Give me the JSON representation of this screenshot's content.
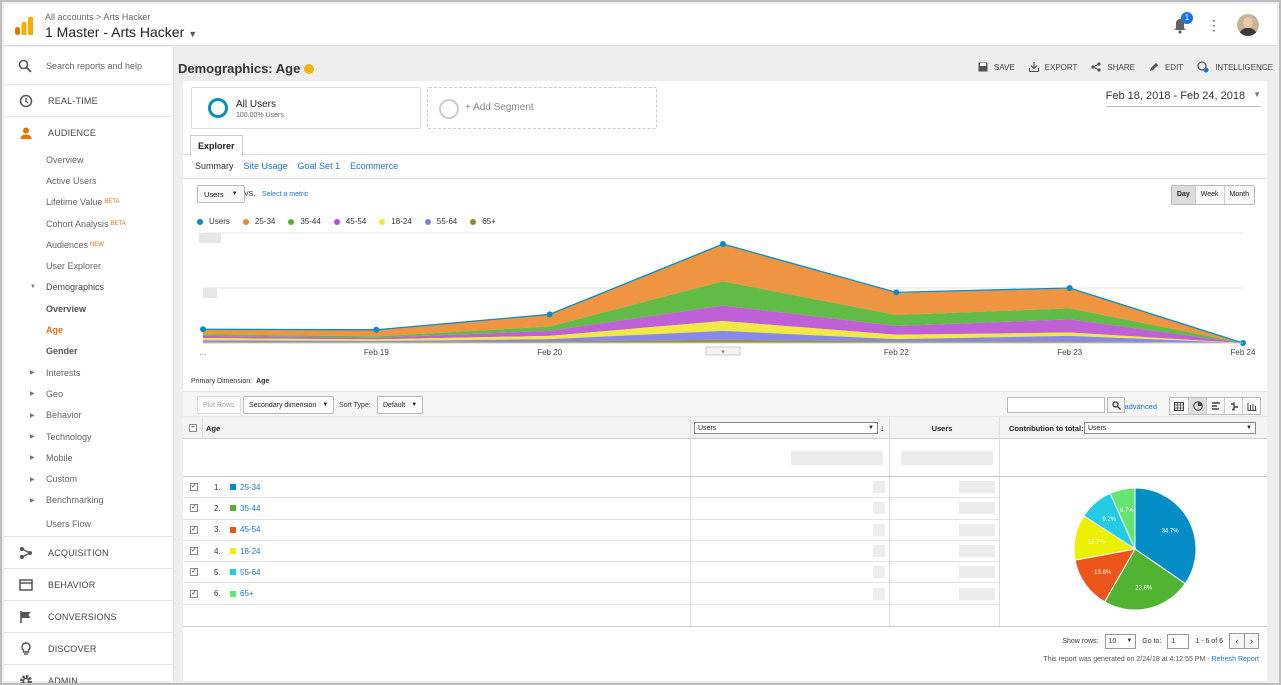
{
  "header": {
    "breadcrumb_accounts": "All accounts",
    "breadcrumb_sep": ">",
    "breadcrumb_property": "Arts Hacker",
    "account_title": "1 Master - Arts Hacker",
    "notification_count": "1"
  },
  "sidebar": {
    "search_placeholder": "Search reports and help",
    "main_items": {
      "realtime": "REAL-TIME",
      "audience": "AUDIENCE",
      "acquisition": "ACQUISITION",
      "behavior": "BEHAVIOR",
      "conversions": "CONVERSIONS",
      "discover": "DISCOVER",
      "admin": "ADMIN"
    },
    "audience_items": {
      "overview": "Overview",
      "active_users": "Active Users",
      "lifetime_value": "Lifetime Value",
      "lifetime_badge": "BETA",
      "cohort": "Cohort Analysis",
      "cohort_badge": "BETA",
      "audiences": "Audiences",
      "audiences_badge": "NEW",
      "user_explorer": "User Explorer",
      "demographics": "Demographics",
      "demo_overview": "Overview",
      "demo_age": "Age",
      "demo_gender": "Gender",
      "interests": "Interests",
      "geo": "Geo",
      "behavior": "Behavior",
      "technology": "Technology",
      "mobile": "Mobile",
      "custom": "Custom",
      "benchmarking": "Benchmarking",
      "users_flow": "Users Flow"
    }
  },
  "report": {
    "title": "Demographics: Age",
    "actions": {
      "save": "SAVE",
      "export": "EXPORT",
      "share": "SHARE",
      "edit": "EDIT",
      "intelligence": "INTELLIGENCE"
    },
    "segment_name": "All Users",
    "segment_sub": "100.00% Users",
    "add_segment": "+ Add Segment",
    "date_range": "Feb 18, 2018 - Feb 24, 2018",
    "tab_explorer": "Explorer",
    "subtabs": [
      "Summary",
      "Site Usage",
      "Goal Set 1",
      "Ecommerce"
    ],
    "metric_select": "Users",
    "vs": "VS.",
    "select_metric": "Select a metric",
    "granularity": [
      "Day",
      "Week",
      "Month"
    ],
    "x_first_label": "...",
    "primary_dimension_label": "Primary Dimension:",
    "primary_dimension_value": "Age",
    "plot_rows": "Plot Rows",
    "secondary_dimension": "Secondary dimension",
    "sort_type_label": "Sort Type:",
    "sort_type_value": "Default",
    "advanced": "advanced"
  },
  "chart_data": {
    "type": "area",
    "x": [
      "Feb 18",
      "Feb 19",
      "Feb 20",
      "Feb 21",
      "Feb 22",
      "Feb 23",
      "Feb 24"
    ],
    "x_tick_labels": [
      "Feb 19",
      "Feb 20",
      "Feb 21",
      "Feb 22",
      "Feb 23",
      "Feb 24"
    ],
    "stacked": true,
    "ylim": [
      0,
      1
    ],
    "grid": true,
    "legend_position": "top-left",
    "series": [
      {
        "name": "Users",
        "color": "#058dc7",
        "style": "line",
        "values": [
          0.125,
          0.12,
          0.26,
          0.9,
          0.46,
          0.5,
          0.0
        ]
      },
      {
        "name": "65+",
        "color": "#8a8a2a",
        "values": [
          0.01,
          0.008,
          0.015,
          0.03,
          0.015,
          0.015,
          0.0
        ]
      },
      {
        "name": "55-64",
        "color": "#7b7bea",
        "values": [
          0.015,
          0.01,
          0.02,
          0.08,
          0.02,
          0.05,
          0.0
        ]
      },
      {
        "name": "18-24",
        "color": "#f0e630",
        "values": [
          0.02,
          0.015,
          0.03,
          0.09,
          0.04,
          0.03,
          0.0
        ]
      },
      {
        "name": "45-54",
        "color": "#b84fd1",
        "values": [
          0.02,
          0.015,
          0.045,
          0.14,
          0.08,
          0.12,
          0.0
        ]
      },
      {
        "name": "35-44",
        "color": "#50b432",
        "values": [
          0.015,
          0.012,
          0.04,
          0.22,
          0.1,
          0.1,
          0.0
        ]
      },
      {
        "name": "25-34",
        "color": "#ed8a2e",
        "values": [
          0.045,
          0.06,
          0.11,
          0.34,
          0.2,
          0.18,
          0.0
        ]
      }
    ]
  },
  "table": {
    "col_age": "Age",
    "col_users_select": "Users",
    "col_users": "Users",
    "contribution_label": "Contribution to total:",
    "contribution_select": "Users",
    "rows": [
      {
        "num": "1.",
        "label": "25-34",
        "color": "#058dc7"
      },
      {
        "num": "2.",
        "label": "35-44",
        "color": "#50b432"
      },
      {
        "num": "3.",
        "label": "45-54",
        "color": "#ed561b"
      },
      {
        "num": "4.",
        "label": "18-24",
        "color": "#edef00"
      },
      {
        "num": "5.",
        "label": "55-64",
        "color": "#24cbe5"
      },
      {
        "num": "6.",
        "label": "65+",
        "color": "#64e572"
      }
    ]
  },
  "pie_data": {
    "type": "pie",
    "slices": [
      {
        "label": "34.7%",
        "value": 34.7,
        "color": "#058dc7"
      },
      {
        "label": "23.8%",
        "value": 23.8,
        "color": "#50b432"
      },
      {
        "label": "13.8%",
        "value": 13.8,
        "color": "#ed561b"
      },
      {
        "label": "12.1%",
        "value": 12.1,
        "color": "#edef00"
      },
      {
        "label": "9.2%",
        "value": 9.2,
        "color": "#24cbe5"
      },
      {
        "label": "6.7%",
        "value": 6.7,
        "color": "#64e572"
      }
    ]
  },
  "pagination": {
    "show_rows_label": "Show rows:",
    "show_rows_value": "10",
    "goto_label": "Go to:",
    "goto_value": "1",
    "range": "1 - 6 of 6"
  },
  "footer": {
    "generated": "This report was generated on 2/24/18 at 4:12:55 PM -",
    "refresh": "Refresh Report"
  }
}
